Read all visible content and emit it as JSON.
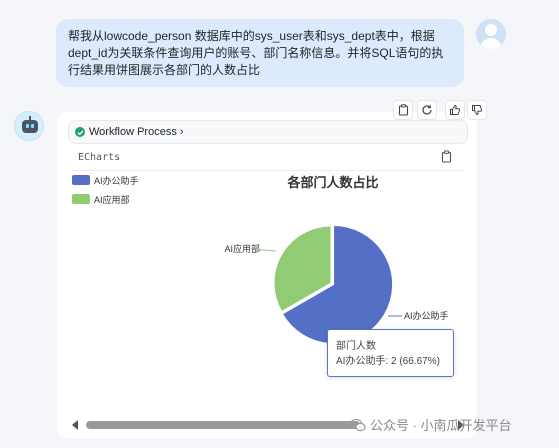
{
  "user_message": {
    "text": "帮我从lowcode_person 数据库中的sys_user表和sys_dept表中，根据dept_id为关联条件查询用户的账号、部门名称信息。并将SQL语句的执行结果用饼图展示各部门的人数占比"
  },
  "actions": {
    "icons": [
      "copy-icon",
      "refresh-icon",
      "thumbs-up-icon",
      "thumbs-down-icon"
    ]
  },
  "workflow": {
    "label": "Workflow Process",
    "status": "success"
  },
  "panel": {
    "label": "ECharts"
  },
  "chart_data": {
    "type": "pie",
    "title": "各部门人数占比",
    "categories": [
      "AI办公助手",
      "AI应用部"
    ],
    "values": [
      2,
      1
    ],
    "series_name": "部门人数",
    "colors": [
      "#5470c6",
      "#91cc75"
    ],
    "legend": {
      "position": "top-left",
      "entries": [
        "AI办公助手",
        "AI应用部"
      ]
    },
    "tooltip": {
      "title": "部门人数",
      "text": "AI办公助手: 2 (66.67%)"
    },
    "highlighted": "AI办公助手"
  },
  "watermark": {
    "text": "公众号 · 小南瓜开发平台"
  }
}
